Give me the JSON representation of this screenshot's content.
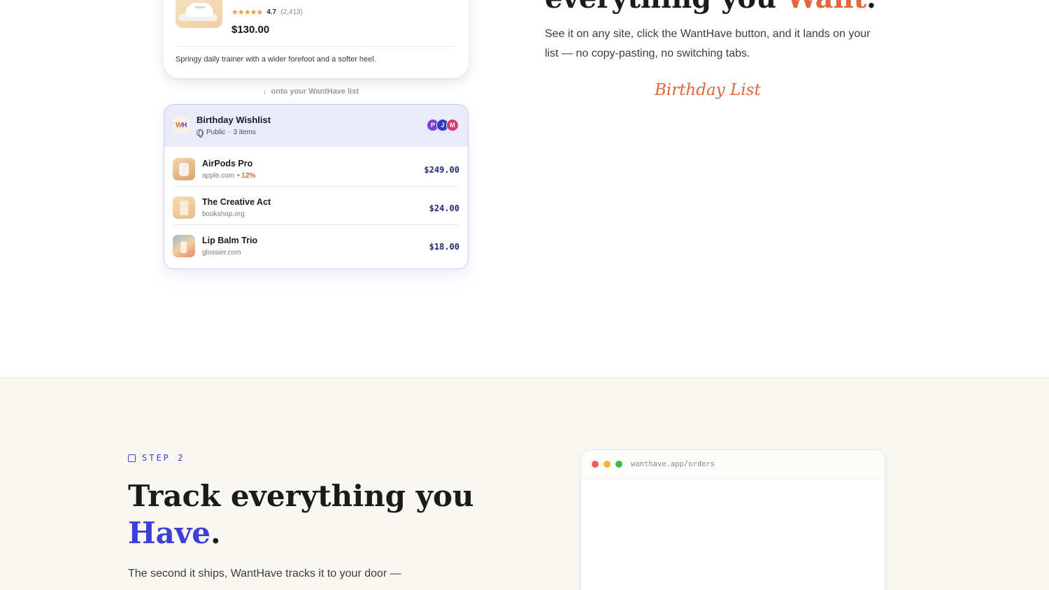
{
  "product": {
    "rating": "4.7",
    "reviews": "(2,413)",
    "stars": "★★★★★",
    "price": "$130.00",
    "description": "Springy daily trainer with a wider forefoot and a softer heel."
  },
  "flow_note": "onto your WantHave list",
  "wishlist": {
    "logo_w": "W",
    "logo_h": "H",
    "title": "Birthday Wishlist",
    "visibility": "Public",
    "separator": "·",
    "count": "3 items",
    "avatars": [
      {
        "letter": "P",
        "color": "#7b3fd6"
      },
      {
        "letter": "J",
        "color": "#2d3bc9"
      },
      {
        "letter": "M",
        "color": "#d63a6e"
      }
    ],
    "items": [
      {
        "name": "AirPods Pro",
        "domain": "apple.com",
        "drop": "• 12%",
        "price": "$249.00"
      },
      {
        "name": "The Creative Act",
        "domain": "bookshop.org",
        "drop": "",
        "price": "$24.00"
      },
      {
        "name": "Lip Balm Trio",
        "domain": "glossier.com",
        "drop": "",
        "price": "$18.00"
      }
    ]
  },
  "section_top": {
    "heading_plain": "everything you ",
    "heading_accent": "Want",
    "heading_end": ".",
    "copy": "See it on any site, click the WantHave button, and it lands on your list — no copy-pasting, no switching tabs.",
    "script_label": "Birthday List"
  },
  "section_bottom": {
    "step": "STEP 2",
    "heading_line1": "Track everything you",
    "heading_accent": "Have",
    "heading_end": ".",
    "copy": "The second it ships, WantHave tracks it to your door —",
    "browser_url": "wanthave.app/orders"
  },
  "colors": {
    "accent_orange": "#e0663e",
    "accent_blue": "#3c3fd6",
    "dot_red": "#ed5f56",
    "dot_yellow": "#f2b531",
    "dot_green": "#3dbb50"
  }
}
